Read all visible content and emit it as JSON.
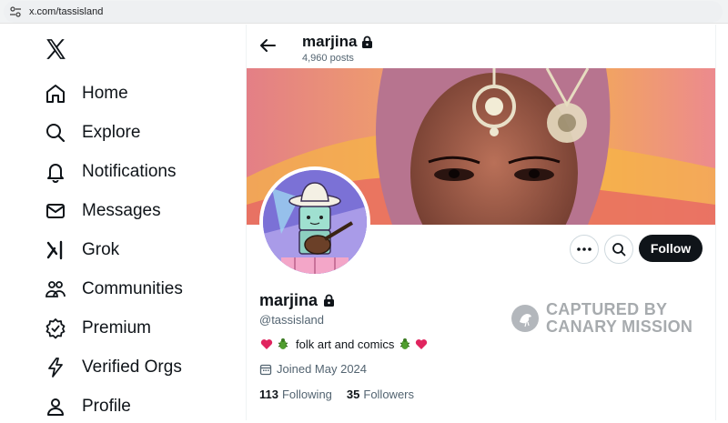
{
  "browser": {
    "url": "x.com/tassisland"
  },
  "nav": {
    "items": [
      {
        "label": "Home"
      },
      {
        "label": "Explore"
      },
      {
        "label": "Notifications"
      },
      {
        "label": "Messages"
      },
      {
        "label": "Grok"
      },
      {
        "label": "Communities"
      },
      {
        "label": "Premium"
      },
      {
        "label": "Verified Orgs"
      },
      {
        "label": "Profile"
      }
    ]
  },
  "header": {
    "name": "marjina",
    "post_count": "4,960 posts"
  },
  "profile": {
    "name": "marjina",
    "handle": "@tassisland",
    "bio": "folk art and comics",
    "joined": "Joined May 2024",
    "following_count": "113",
    "following_label": "Following",
    "followers_count": "35",
    "followers_label": "Followers"
  },
  "actions": {
    "follow_label": "Follow"
  },
  "watermark": {
    "line1": "CAPTURED BY",
    "line2": "CANARY MISSION"
  },
  "colors": {
    "primary_text": "#0f1419",
    "secondary_text": "#536471",
    "follow_bg": "#0f1419",
    "border": "#cfd9de"
  }
}
